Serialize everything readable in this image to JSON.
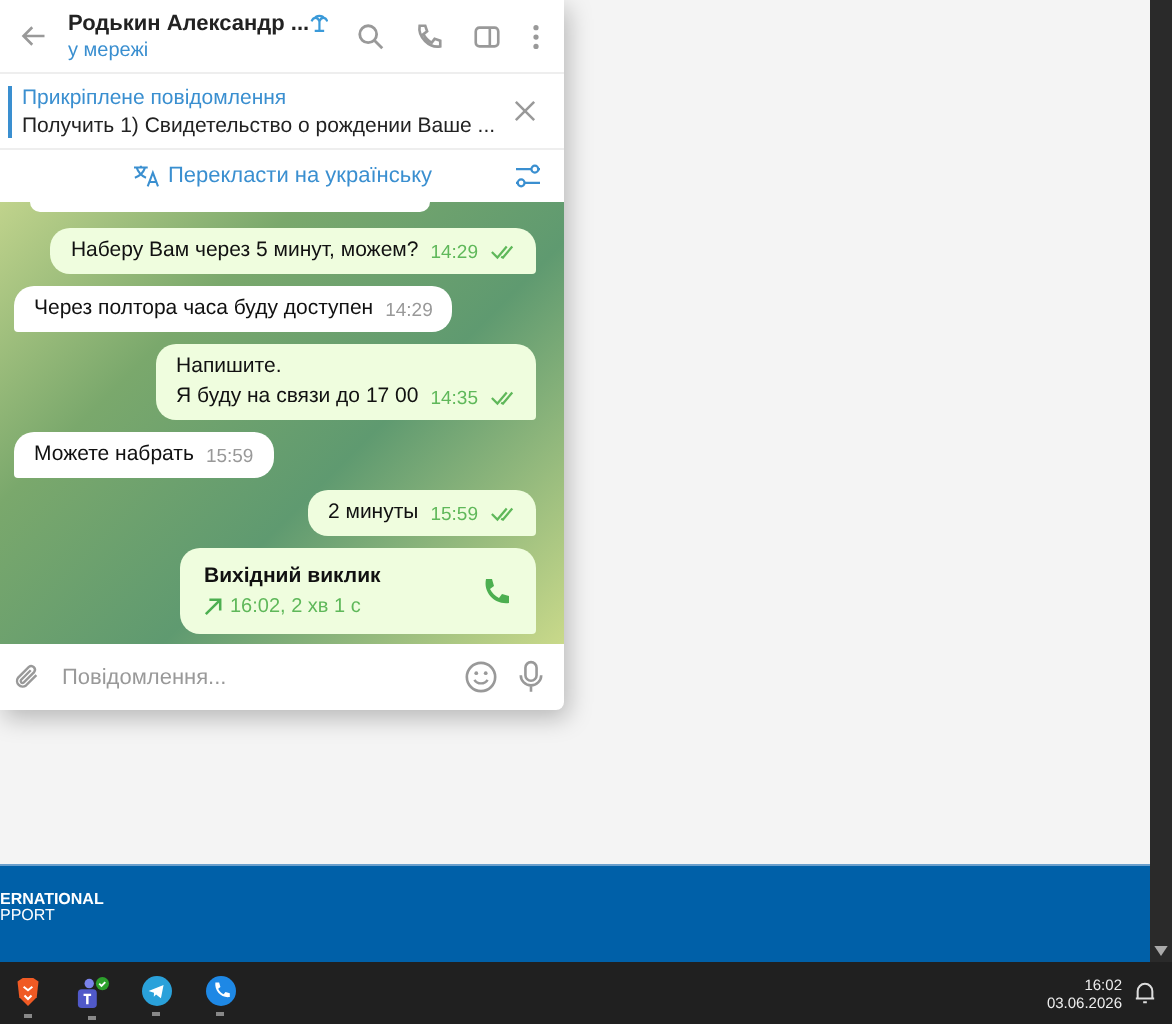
{
  "chat": {
    "name": "Родькин Александр ...",
    "status": "у мережі"
  },
  "pinned": {
    "title": "Прикріплене повідомлення",
    "text": "Получить  1) Свидетельство о рождении Ваше ..."
  },
  "translate": {
    "label": "Перекласти на українську"
  },
  "messages": [
    {
      "kind": "out",
      "lines": [
        "Наберу Вам через 5 минут, можем?"
      ],
      "time": "14:29",
      "read": true
    },
    {
      "kind": "in",
      "lines": [
        "Через полтора часа буду доступен"
      ],
      "time": "14:29"
    },
    {
      "kind": "out",
      "lines": [
        "Напишите.",
        "Я буду на связи до 17 00"
      ],
      "time": "14:35",
      "read": true
    },
    {
      "kind": "in",
      "lines": [
        "Можете набрать"
      ],
      "time": "15:59"
    },
    {
      "kind": "out",
      "lines": [
        "2 минуты"
      ],
      "time": "15:59",
      "read": true
    },
    {
      "kind": "call",
      "title": "Вихідний виклик",
      "detail": "16:02, 2 хв 1 с"
    }
  ],
  "composer": {
    "placeholder": "Повідомлення..."
  },
  "banner": {
    "lines": [
      "ERNATIONAL",
      "PPORT"
    ]
  },
  "taskbar": {
    "time": "16:02",
    "date": "03.06.2026"
  }
}
